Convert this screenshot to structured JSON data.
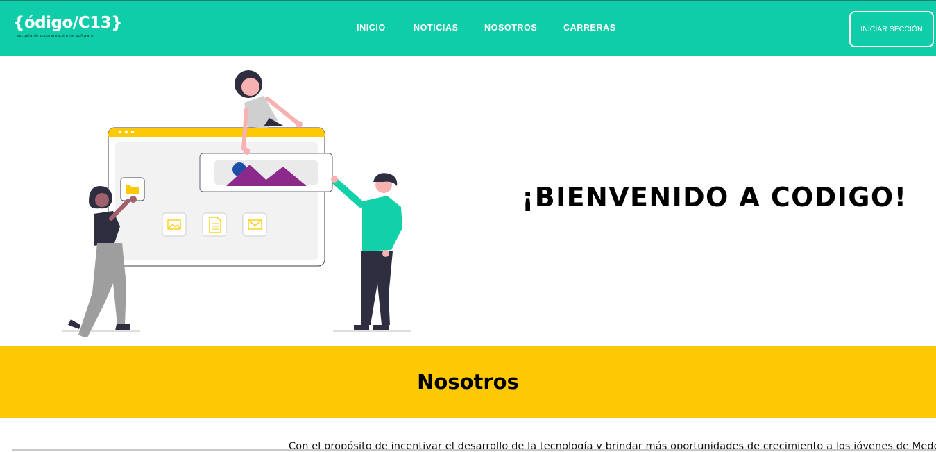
{
  "brand": {
    "logo_main": "{ódigo/C13}",
    "logo_tagline": "escuela de programación de software"
  },
  "colors": {
    "header_bg": "#10cdaa",
    "band_bg": "#fdc904",
    "accent_purple": "#8b2a8a",
    "accent_teal": "#12d1a8"
  },
  "nav": {
    "items": [
      {
        "label": "INICIO"
      },
      {
        "label": "NOTICIAS"
      },
      {
        "label": "NOSOTROS"
      },
      {
        "label": "CARRERAS"
      }
    ],
    "login_label": "INICIAR SECCIÓN"
  },
  "hero": {
    "title": "¡BIENVENIDO A CODIGO!",
    "illustration_icons": [
      "folder-icon",
      "image-icon",
      "document-icon",
      "mail-icon",
      "landscape-image-icon"
    ]
  },
  "about": {
    "heading": "Nosotros",
    "text_partial": "Con el propósito de incentivar el desarrollo de la tecnología y brindar más oportunidades de crecimiento a los jóvenes de Medellín"
  }
}
